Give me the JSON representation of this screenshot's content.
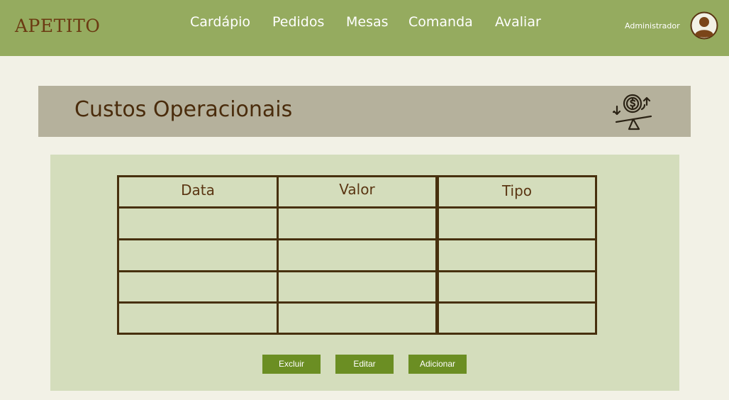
{
  "header": {
    "brand": "APETITO",
    "nav": [
      "Cardápio",
      "Pedidos",
      "Mesas",
      "Comanda",
      "Avaliar"
    ],
    "user_label": "Administrador",
    "avatar_icon": "user-avatar-icon"
  },
  "banner": {
    "title": "Custos Operacionais",
    "icon": "operational-costs-balance-icon"
  },
  "table": {
    "columns": [
      "Data",
      "Valor",
      "Tipo"
    ],
    "rows": [
      [
        "",
        "",
        ""
      ],
      [
        "",
        "",
        ""
      ],
      [
        "",
        "",
        ""
      ],
      [
        "",
        "",
        ""
      ]
    ]
  },
  "actions": {
    "delete": "Excluir",
    "edit": "Editar",
    "add": "Adicionar"
  },
  "colors": {
    "topbar": "#95ab5f",
    "brand": "#6b3a12",
    "banner": "#b5b19c",
    "panel": "#d4ddbc",
    "button": "#6b8e23",
    "grid": "#47300e",
    "page": "#f2f1e6"
  }
}
